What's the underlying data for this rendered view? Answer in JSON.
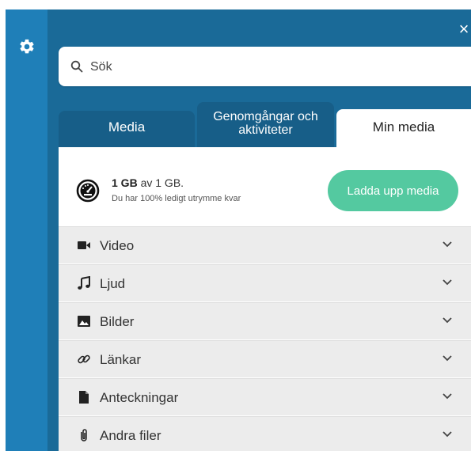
{
  "close_label": "×",
  "search": {
    "placeholder": "Sök"
  },
  "tabs": [
    {
      "label": "Media"
    },
    {
      "label_line1": "Genomgångar och",
      "label_line2": "aktiviteter"
    },
    {
      "label": "Min media"
    }
  ],
  "storage": {
    "used": "1 GB",
    "of_text": "av 1 GB.",
    "free_text": "Du har 100% ledigt utrymme kvar"
  },
  "upload_label": "Ladda upp media",
  "categories": [
    {
      "label": "Video",
      "icon": "video-camera-icon"
    },
    {
      "label": "Ljud",
      "icon": "music-note-icon"
    },
    {
      "label": "Bilder",
      "icon": "image-icon"
    },
    {
      "label": "Länkar",
      "icon": "link-icon"
    },
    {
      "label": "Anteckningar",
      "icon": "document-icon"
    },
    {
      "label": "Andra filer",
      "icon": "paperclip-icon"
    }
  ],
  "colors": {
    "rail": "#1f7fb8",
    "panel": "#1a6a98",
    "tab_inactive": "#175e88",
    "upload_button": "#54c9a0",
    "category_bg": "#ececec"
  }
}
